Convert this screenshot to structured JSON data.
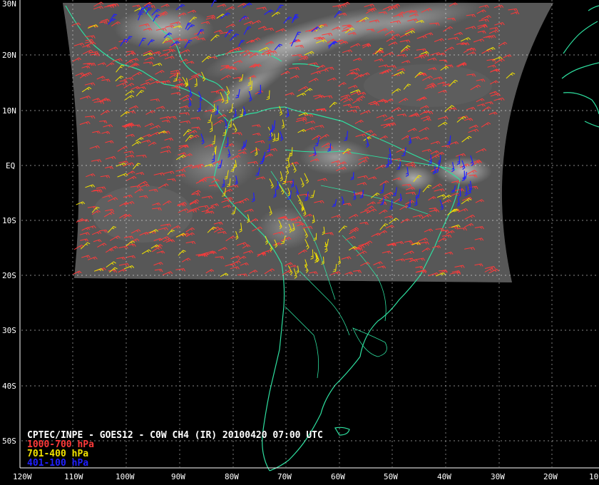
{
  "title": "CPTEC/INPE - GOES12 - C0W CH4 (IR) 20100420 07:00 UTC",
  "legend": [
    {
      "label": "1000-700 hPa",
      "color": "#ff3a3a"
    },
    {
      "label": "701-400 hPa",
      "color": "#f2e200"
    },
    {
      "label": "401-100 hPa",
      "color": "#2020ff"
    }
  ],
  "lat_labels": [
    "30N",
    "20N",
    "10N",
    "EQ",
    "10S",
    "20S",
    "30S",
    "40S",
    "50S"
  ],
  "lon_labels": [
    "120W",
    "110W",
    "100W",
    "90W",
    "80W",
    "70W",
    "60W",
    "50W",
    "40W",
    "30W",
    "20W",
    "10"
  ],
  "colors": {
    "background": "#000000",
    "coastline": "#2ee0a0",
    "grid": "#ffffff",
    "satellite_gray": "#6a6a6a"
  },
  "satellite_image": "goes12-infrared-cloud-field"
}
